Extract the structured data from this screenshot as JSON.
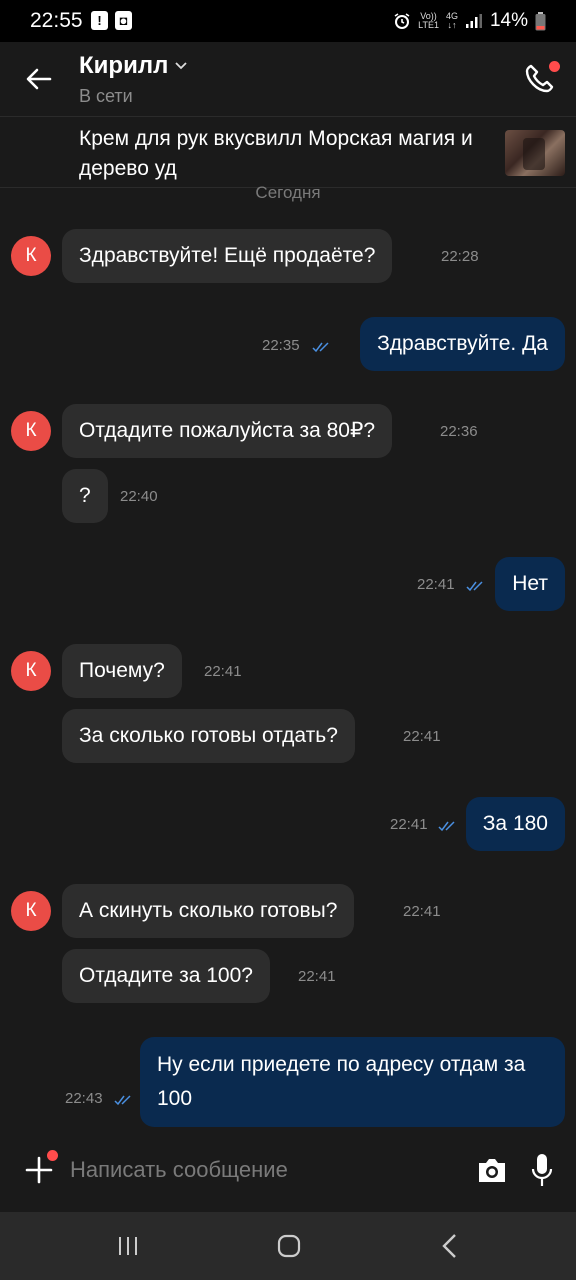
{
  "status_bar": {
    "time": "22:55",
    "network_top": "Vo))",
    "network_bottom": "LTE1",
    "gen": "4G",
    "battery": "14%"
  },
  "header": {
    "contact_name": "Кирилл",
    "contact_status": "В сети"
  },
  "product": {
    "title": "Крем для рук вкусвилл Морская магия и дерево уд"
  },
  "chat": {
    "date_label": "Сегодня",
    "avatar_letter": "К",
    "messages": [
      {
        "text": "Здравствуйте! Ещё продаёте?",
        "time": "22:28"
      },
      {
        "text": "Здравствуйте. Да",
        "time": "22:35"
      },
      {
        "text": "Отдадите пожалуйста за 80₽?",
        "time": "22:36"
      },
      {
        "text": "?",
        "time": "22:40"
      },
      {
        "text": "Нет",
        "time": "22:41"
      },
      {
        "text": "Почему?",
        "time": "22:41"
      },
      {
        "text": "За сколько готовы отдать?",
        "time": "22:41"
      },
      {
        "text": "За 180",
        "time": "22:41"
      },
      {
        "text": "А скинуть сколько готовы?",
        "time": "22:41"
      },
      {
        "text": "Отдадите за 100?",
        "time": "22:41"
      },
      {
        "text": "Ну если приедете по адресу отдам за 100",
        "time": "22:43"
      }
    ]
  },
  "composer": {
    "placeholder": "Написать сообщение"
  },
  "colors": {
    "background": "#1a1a1a",
    "incoming_bubble": "#2d2d2d",
    "outgoing_bubble": "#0a2a4f",
    "avatar": "#ea4c46",
    "notification_dot": "#ff4c4c",
    "read_ticks": "#4a90e2"
  },
  "icons": [
    "back-arrow-icon",
    "chevron-down-icon",
    "phone-icon",
    "plus-icon",
    "camera-icon",
    "microphone-icon",
    "read-ticks-icon"
  ]
}
